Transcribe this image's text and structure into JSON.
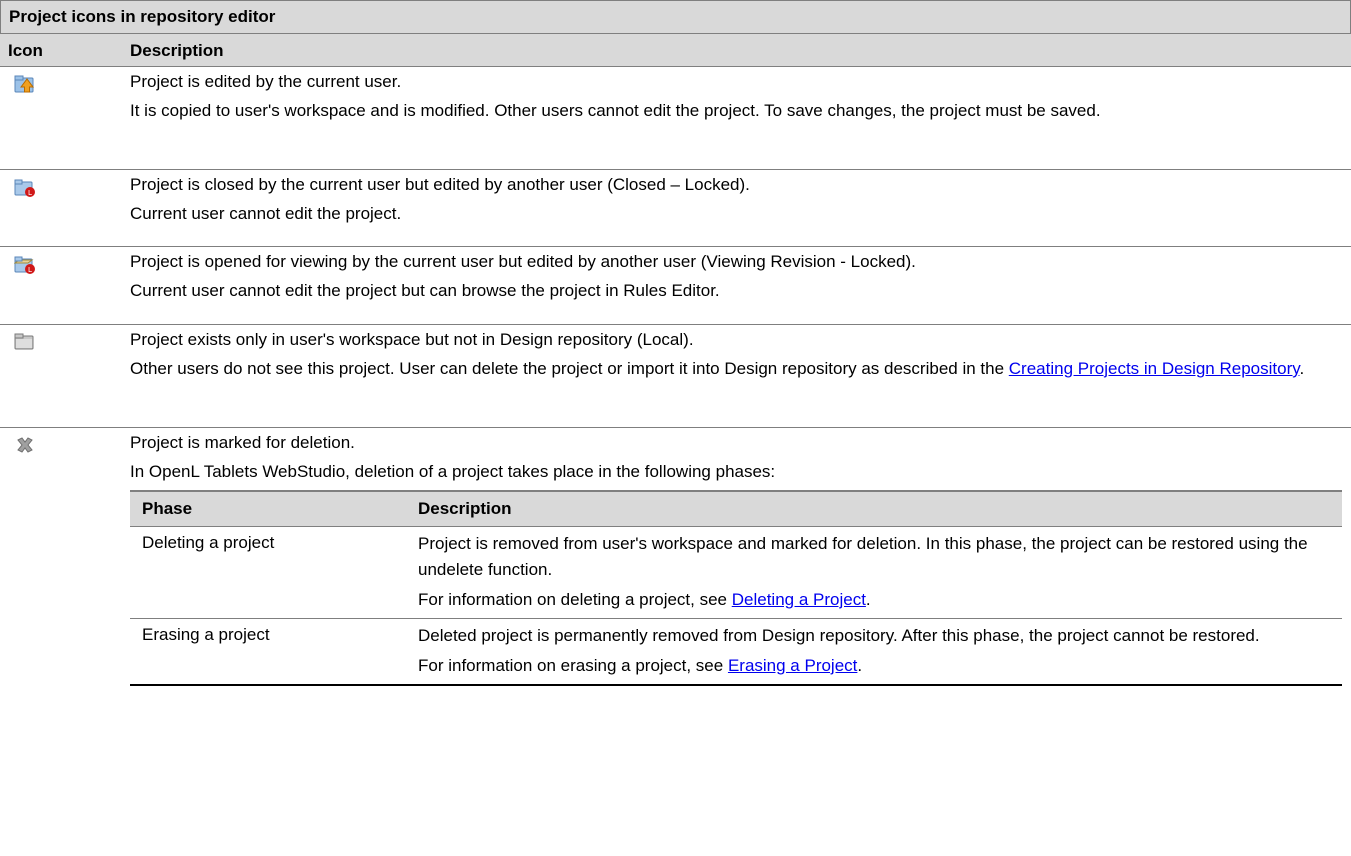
{
  "caption": "Project icons in repository editor",
  "header": {
    "icon": "Icon",
    "description": "Description"
  },
  "rows": [
    {
      "icon": "project-edit-icon",
      "line1": "Project is edited by the current user.",
      "line2": "It is copied to user's workspace and is modified. Other users cannot edit the project. To save changes, the project must be saved."
    },
    {
      "icon": "project-closed-locked-icon",
      "line1": "Project is closed by the current user but edited by another user (Closed – Locked).",
      "line2": "Current user cannot edit the project."
    },
    {
      "icon": "project-viewing-locked-icon",
      "line1": "Project is opened for viewing by the current user but edited by another user (Viewing Revision - Locked).",
      "line2": "Current user cannot edit the project but can browse the project in Rules Editor."
    },
    {
      "icon": "project-local-icon",
      "line1": "Project exists only in user's workspace but not in Design repository (Local).",
      "line2_pre": "Other users do not see this project. User can delete the project or import it into Design repository as described in the ",
      "line2_link": "Creating Projects in Design Repository",
      "line2_post": "."
    },
    {
      "icon": "project-deleted-icon",
      "line1": "Project is marked for deletion.",
      "line2": "In OpenL Tablets WebStudio, deletion of a project takes place in the following phases:",
      "sub": {
        "header": {
          "phase": "Phase",
          "description": "Description"
        },
        "rows": [
          {
            "phase": "Deleting a project",
            "desc": "Project is removed from user's workspace and marked for deletion. In this phase, the project can be restored using the undelete function.",
            "info_pre": "For information on deleting a project, see ",
            "info_link": "Deleting a Project",
            "info_post": "."
          },
          {
            "phase": "Erasing a project",
            "desc": "Deleted project is permanently removed from Design repository. After this phase, the project cannot be restored.",
            "info_pre": "For information on erasing a project, see ",
            "info_link": "Erasing a Project",
            "info_post": "."
          }
        ]
      }
    }
  ]
}
